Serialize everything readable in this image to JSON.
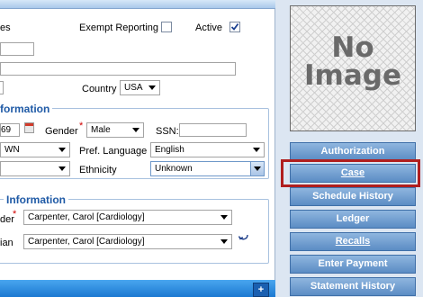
{
  "header": {
    "partial_label": "es",
    "exempt_label": "Exempt Reporting",
    "active_label": "Active",
    "exempt_checked": false,
    "active_checked": true
  },
  "address": {
    "country_label": "Country",
    "country_value": "USA"
  },
  "demographics": {
    "section_title": "formation",
    "dob_partial": "69",
    "gender_label": "Gender",
    "gender_value": "Male",
    "ssn_label": "SSN:",
    "ssn_value": "",
    "race_partial": "WN",
    "pref_language_label": "Pref. Language",
    "pref_language_value": "English",
    "ethnicity_label": "Ethnicity",
    "ethnicity_value": "Unknown"
  },
  "providers": {
    "section_title": "Information",
    "provider1_label_partial": "der",
    "provider1_value": "Carpenter, Carol [Cardiology]",
    "provider2_label_partial": "ian",
    "provider2_value": "Carpenter, Carol [Cardiology]"
  },
  "bottom": {
    "plus_label": "+"
  },
  "image": {
    "placeholder_line1": "No",
    "placeholder_line2": "Image"
  },
  "actions": {
    "authorization": "Authorization",
    "case": "Case",
    "schedule_history": "Schedule History",
    "ledger": "Ledger",
    "recalls": "Recalls",
    "enter_payment": "Enter Payment",
    "statement_history": "Statement History"
  },
  "colors": {
    "section_title": "#1f5aa6",
    "button_top": "#8fb6df",
    "button_bottom": "#5b8cc4",
    "highlight": "#b01e1e",
    "required_marker": "#d00000"
  }
}
